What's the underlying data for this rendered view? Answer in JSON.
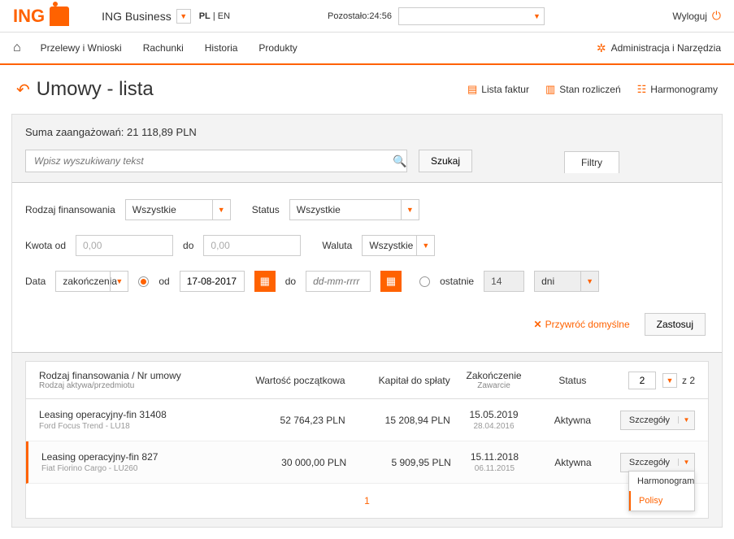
{
  "header": {
    "logo": "ING",
    "app_name": "ING Business",
    "lang_active": "PL",
    "lang_other": "EN",
    "timer_label": "Pozostało:",
    "timer_value": "24:56",
    "logout": "Wyloguj"
  },
  "menu": {
    "items": [
      "Przelewy i Wnioski",
      "Rachunki",
      "Historia",
      "Produkty"
    ],
    "admin": "Administracja i Narzędzia"
  },
  "page": {
    "title": "Umowy - lista",
    "actions": [
      "Lista faktur",
      "Stan rozliczeń",
      "Harmonogramy"
    ]
  },
  "summary": {
    "label": "Suma zaangażowań:",
    "value": "21 118,89 PLN"
  },
  "search": {
    "placeholder": "Wpisz wyszukiwany tekst",
    "button": "Szukaj",
    "filters_tab": "Filtry"
  },
  "filters": {
    "financing_label": "Rodzaj finansowania",
    "financing_value": "Wszystkie",
    "status_label": "Status",
    "status_value": "Wszystkie",
    "amount_from_label": "Kwota od",
    "amount_from_value": "0,00",
    "amount_to_label": "do",
    "amount_to_value": "0,00",
    "currency_label": "Waluta",
    "currency_value": "Wszystkie",
    "date_label": "Data",
    "date_type": "zakończenia",
    "from_label": "od",
    "from_value": "17-08-2017",
    "to_label": "do",
    "to_placeholder": "dd-mm-rrrr",
    "last_label": "ostatnie",
    "last_value": "14",
    "last_unit": "dni",
    "reset": "Przywróć domyślne",
    "apply": "Zastosuj"
  },
  "table": {
    "headers": {
      "col1": "Rodzaj finansowania / Nr umowy",
      "col1_sub": "Rodzaj aktywa/przedmiotu",
      "col2": "Wartość początkowa",
      "col3": "Kapitał do spłaty",
      "col4": "Zakończenie",
      "col4_sub": "Zawarcie",
      "col5": "Status",
      "pager_value": "2",
      "pager_total": "z 2"
    },
    "rows": [
      {
        "name": "Leasing operacyjny-fin 31408",
        "sub": "Ford Focus Trend - LU18",
        "initial": "52 764,23 PLN",
        "capital": "15 208,94 PLN",
        "end": "15.05.2019",
        "start": "28.04.2016",
        "status": "Aktywna",
        "details": "Szczegóły"
      },
      {
        "name": "Leasing operacyjny-fin 827",
        "sub": "Fiat Fiorino Cargo - LU260",
        "initial": "30 000,00 PLN",
        "capital": "5 909,95 PLN",
        "end": "15.11.2018",
        "start": "06.11.2015",
        "status": "Aktywna",
        "details": "Szczegóły"
      }
    ],
    "dropdown": {
      "item1": "Harmonogram",
      "item2": "Polisy"
    },
    "page_current": "1",
    "page_total": "2"
  }
}
